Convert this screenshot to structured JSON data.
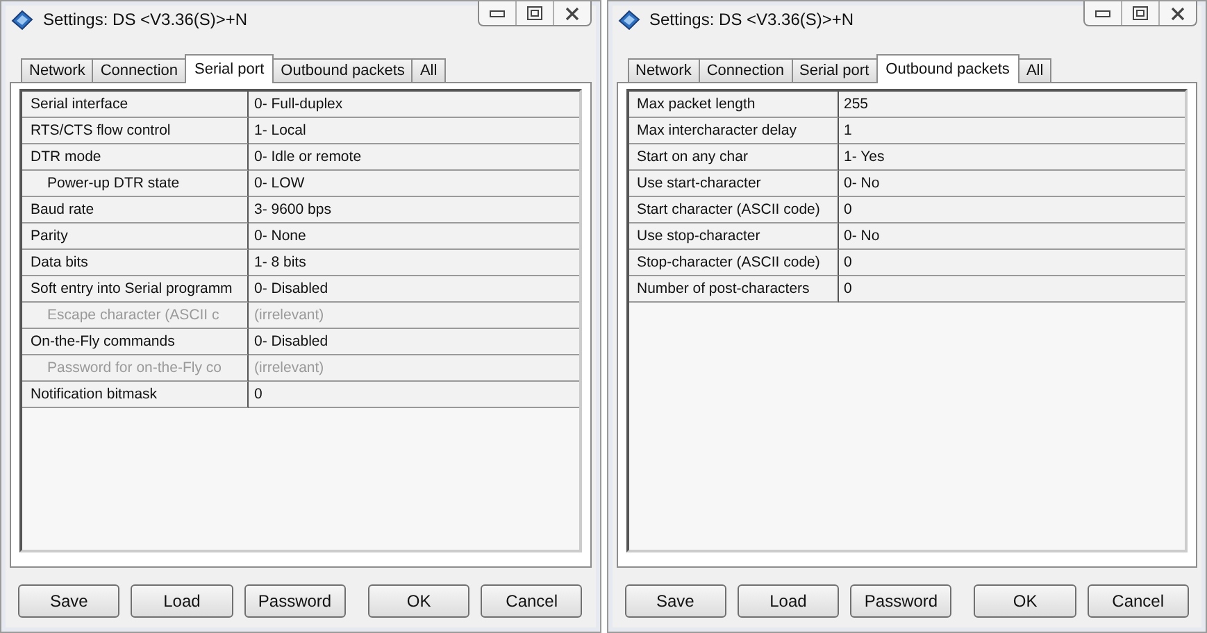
{
  "windows": [
    {
      "title": "Settings: DS <V3.36(S)>+N",
      "tabs": [
        {
          "label": "Network",
          "selected": false
        },
        {
          "label": "Connection",
          "selected": false
        },
        {
          "label": "Serial port",
          "selected": true
        },
        {
          "label": "Outbound packets",
          "selected": false
        },
        {
          "label": "All",
          "selected": false
        }
      ],
      "rows": [
        {
          "label": "Serial interface",
          "value": "0- Full-duplex",
          "disabled": false
        },
        {
          "label": "RTS/CTS flow control",
          "value": "1- Local",
          "disabled": false
        },
        {
          "label": "DTR mode",
          "value": "0- Idle or remote",
          "disabled": false,
          "children": [
            {
              "label": "Power-up DTR state",
              "value": "0- LOW",
              "disabled": false
            }
          ]
        },
        {
          "label": "Baud rate",
          "value": "3- 9600 bps",
          "disabled": false
        },
        {
          "label": "Parity",
          "value": "0- None",
          "disabled": false
        },
        {
          "label": "Data bits",
          "value": "1- 8 bits",
          "disabled": false
        },
        {
          "label": "Soft entry into Serial programm",
          "value": "0- Disabled",
          "disabled": false,
          "children": [
            {
              "label": "Escape character (ASCII c",
              "value": "(irrelevant)",
              "disabled": true
            }
          ]
        },
        {
          "label": "On-the-Fly commands",
          "value": "0- Disabled",
          "disabled": false,
          "children": [
            {
              "label": "Password for on-the-Fly co",
              "value": "(irrelevant)",
              "disabled": true
            }
          ]
        },
        {
          "label": "Notification bitmask",
          "value": "0",
          "disabled": false
        }
      ],
      "buttons": [
        "Save",
        "Load",
        "Password",
        "OK",
        "Cancel"
      ]
    },
    {
      "title": "Settings: DS <V3.36(S)>+N",
      "tabs": [
        {
          "label": "Network",
          "selected": false
        },
        {
          "label": "Connection",
          "selected": false
        },
        {
          "label": "Serial port",
          "selected": false
        },
        {
          "label": "Outbound packets",
          "selected": true
        },
        {
          "label": "All",
          "selected": false
        }
      ],
      "rows": [
        {
          "label": "Max packet length",
          "value": "255",
          "disabled": false
        },
        {
          "label": "Max intercharacter delay",
          "value": "1",
          "disabled": false
        },
        {
          "label": "Start on any char",
          "value": "1- Yes",
          "disabled": false
        },
        {
          "label": "Use start-character",
          "value": "0- No",
          "disabled": false
        },
        {
          "label": "Start character (ASCII code)",
          "value": "0",
          "disabled": false
        },
        {
          "label": "Use stop-character",
          "value": "0- No",
          "disabled": false
        },
        {
          "label": "Stop-character (ASCII code)",
          "value": "0",
          "disabled": false
        },
        {
          "label": "Number of post-characters",
          "value": "0",
          "disabled": false
        }
      ],
      "buttons": [
        "Save",
        "Load",
        "Password",
        "OK",
        "Cancel"
      ]
    }
  ]
}
